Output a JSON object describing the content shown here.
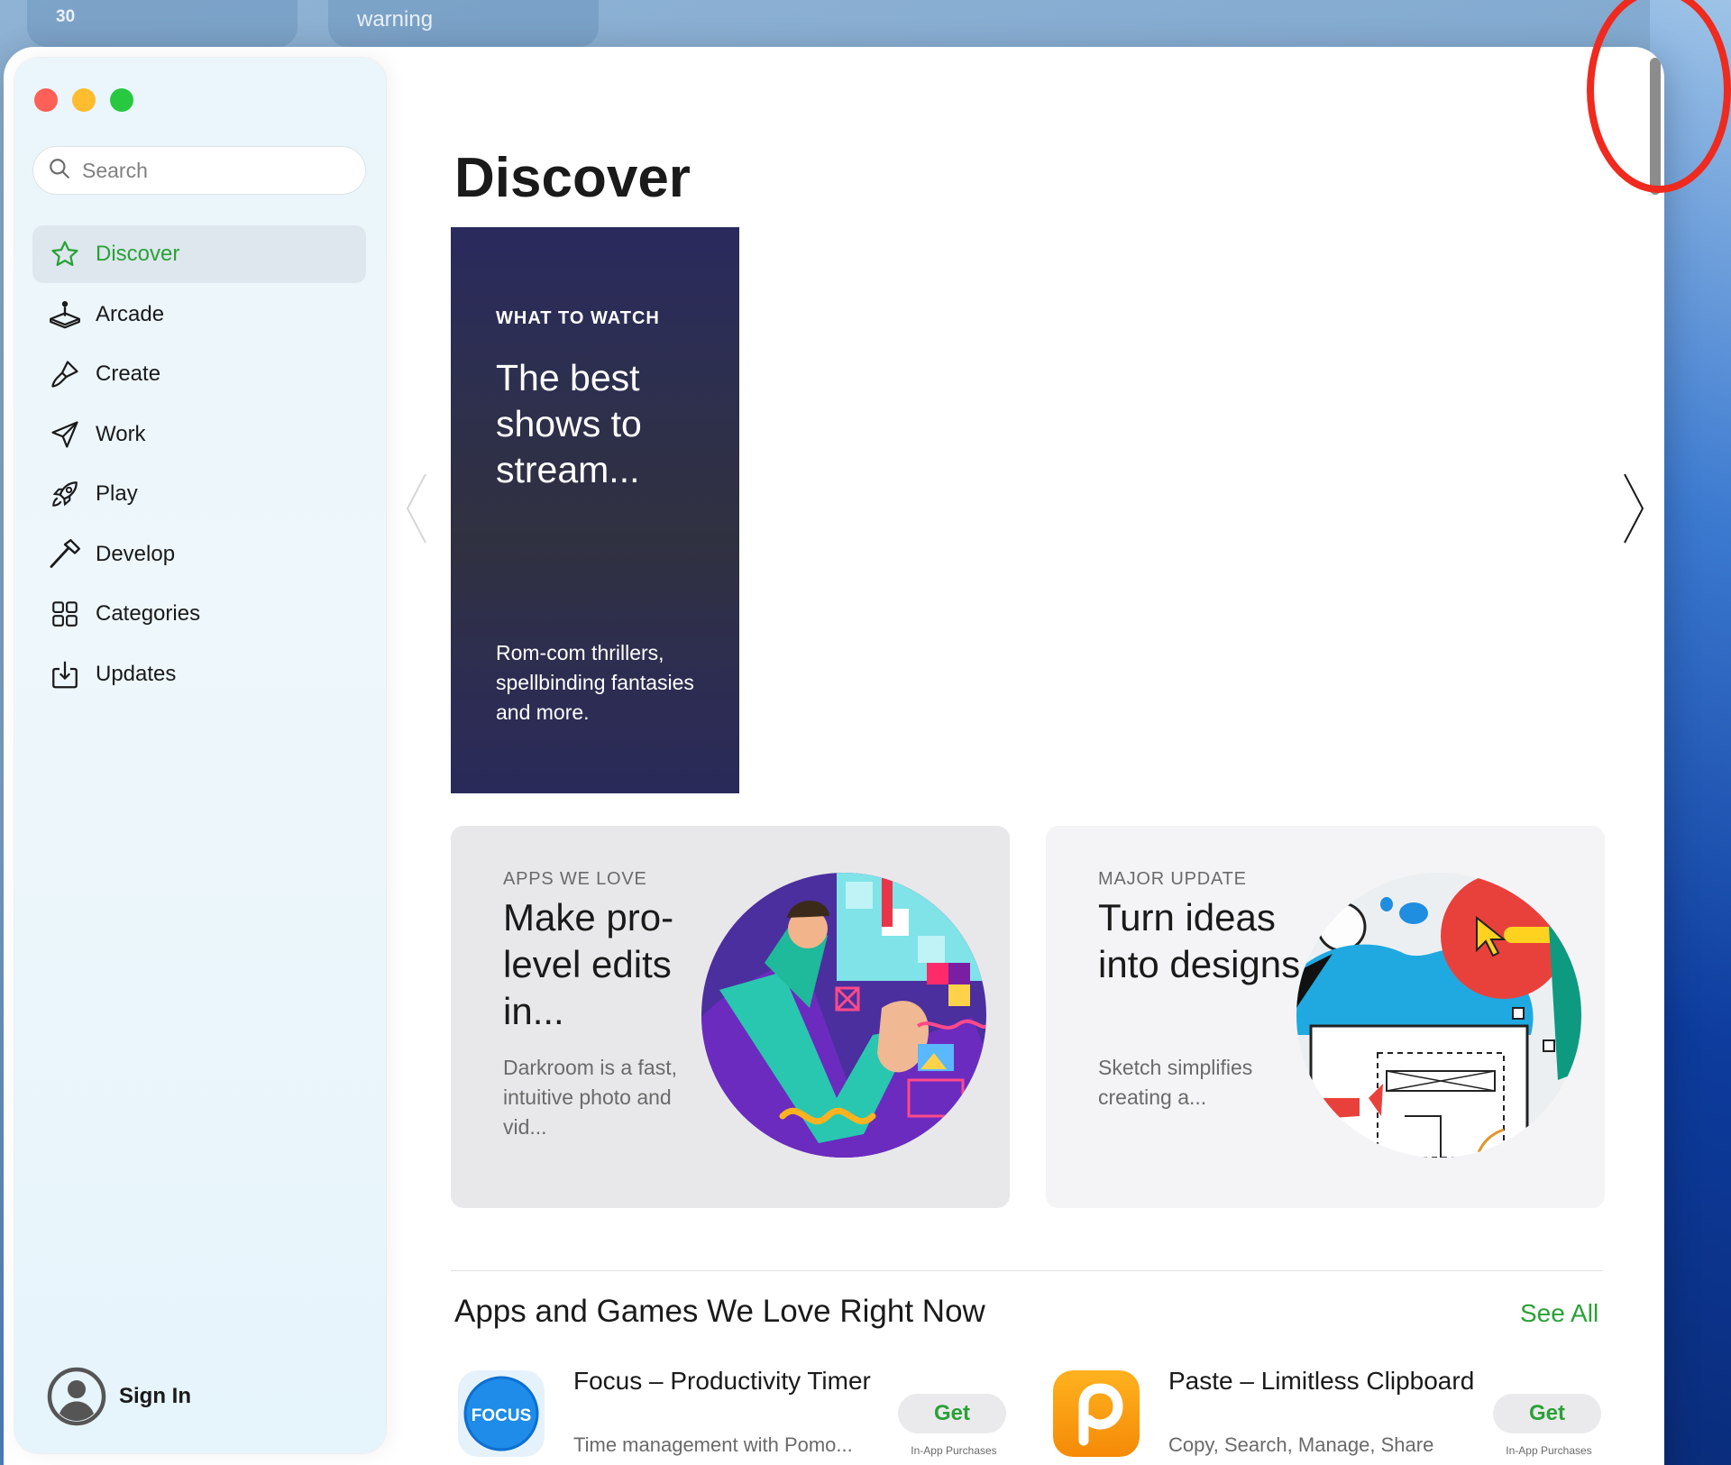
{
  "desktop": {
    "widget_1_text": "30",
    "widget_2_text": "warning"
  },
  "sidebar": {
    "search": {
      "placeholder": "Search"
    },
    "items": [
      {
        "label": "Discover",
        "icon": "star-icon",
        "active": true
      },
      {
        "label": "Arcade",
        "icon": "joystick-icon",
        "active": false
      },
      {
        "label": "Create",
        "icon": "brush-icon",
        "active": false
      },
      {
        "label": "Work",
        "icon": "paper-plane-icon",
        "active": false
      },
      {
        "label": "Play",
        "icon": "rocket-icon",
        "active": false
      },
      {
        "label": "Develop",
        "icon": "hammer-icon",
        "active": false
      },
      {
        "label": "Categories",
        "icon": "grid-icon",
        "active": false
      },
      {
        "label": "Updates",
        "icon": "download-icon",
        "active": false
      }
    ],
    "sign_in": "Sign In"
  },
  "main": {
    "title": "Discover",
    "hero": {
      "eyebrow": "WHAT TO WATCH",
      "headline": "The best shows to stream...",
      "description": "Rom-com thrillers, spellbinding fantasies and more."
    },
    "cards": [
      {
        "eyebrow": "APPS WE LOVE",
        "headline": "Make pro-level edits in...",
        "description": "Darkroom is a fast, intuitive photo and vid..."
      },
      {
        "eyebrow": "MAJOR UPDATE",
        "headline": "Turn ideas into designs",
        "description": "Sketch simplifies creating a..."
      }
    ],
    "section": {
      "title": "Apps and Games We Love Right Now",
      "see_all": "See All"
    },
    "apps": [
      {
        "name": "Focus – Productivity Timer",
        "subtitle": "Time management with Pomo...",
        "icon_text": "FOCUS",
        "button": "Get",
        "note": "In-App Purchases"
      },
      {
        "name": "Paste – Limitless Clipboard",
        "subtitle": "Copy, Search, Manage, Share",
        "button": "Get",
        "note": "In-App Purchases"
      }
    ]
  },
  "colors": {
    "accent_green": "#2aa137",
    "annotation_red": "#ef2a1e"
  }
}
